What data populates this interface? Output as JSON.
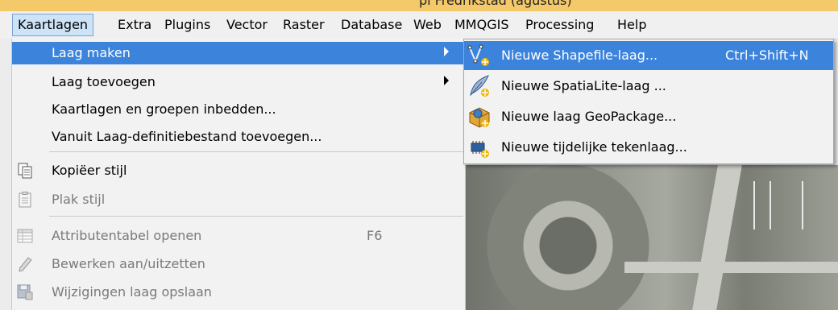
{
  "title_fragment": "pi Fredrikstad (agustus)",
  "menubar": {
    "items": [
      "Kaartlagen",
      "Extra",
      "Plugins",
      "Vector",
      "Raster",
      "Database",
      "Web",
      "MMQGIS",
      "Processing",
      "Help"
    ],
    "active": "Kaartlagen"
  },
  "dropdown": {
    "items": [
      {
        "label": "Laag maken",
        "submenu": true,
        "highlighted": true,
        "disabled": false
      },
      {
        "label": "Laag toevoegen",
        "submenu": true,
        "highlighted": false,
        "disabled": false
      },
      {
        "label": "Kaartlagen en groepen inbedden...",
        "submenu": false,
        "highlighted": false,
        "disabled": false
      },
      {
        "label": "Vanuit Laag-definitiebestand toevoegen...",
        "submenu": false,
        "highlighted": false,
        "disabled": false
      },
      {
        "label": "Kopiëer stijl",
        "icon": "copy-style-icon",
        "disabled": false
      },
      {
        "label": "Plak stijl",
        "icon": "paste-style-icon",
        "disabled": true
      },
      {
        "label": "Attributentabel openen",
        "shortcut": "F6",
        "icon": "attribute-table-icon",
        "disabled": true
      },
      {
        "label": "Bewerken aan/uitzetten",
        "icon": "pencil-icon",
        "disabled": true
      },
      {
        "label": "Wijzigingen laag opslaan",
        "icon": "save-edits-icon",
        "disabled": true
      }
    ]
  },
  "submenu": {
    "items": [
      {
        "label": "Nieuwe Shapefile-laag...",
        "shortcut": "Ctrl+Shift+N",
        "icon": "new-shapefile-icon",
        "highlighted": true
      },
      {
        "label": "Nieuwe SpatiaLite-laag ...",
        "shortcut": "",
        "icon": "new-spatialite-icon",
        "highlighted": false
      },
      {
        "label": "Nieuwe laag GeoPackage...",
        "shortcut": "",
        "icon": "new-geopackage-icon",
        "highlighted": false
      },
      {
        "label": "Nieuwe tijdelijke tekenlaag...",
        "shortcut": "",
        "icon": "new-scratch-layer-icon",
        "highlighted": false
      }
    ]
  },
  "colors": {
    "highlight": "#3b83db",
    "menu_bg": "#f2f2f2",
    "active_menubar": "#cde3f7",
    "disabled_text": "#7a7a7a"
  }
}
